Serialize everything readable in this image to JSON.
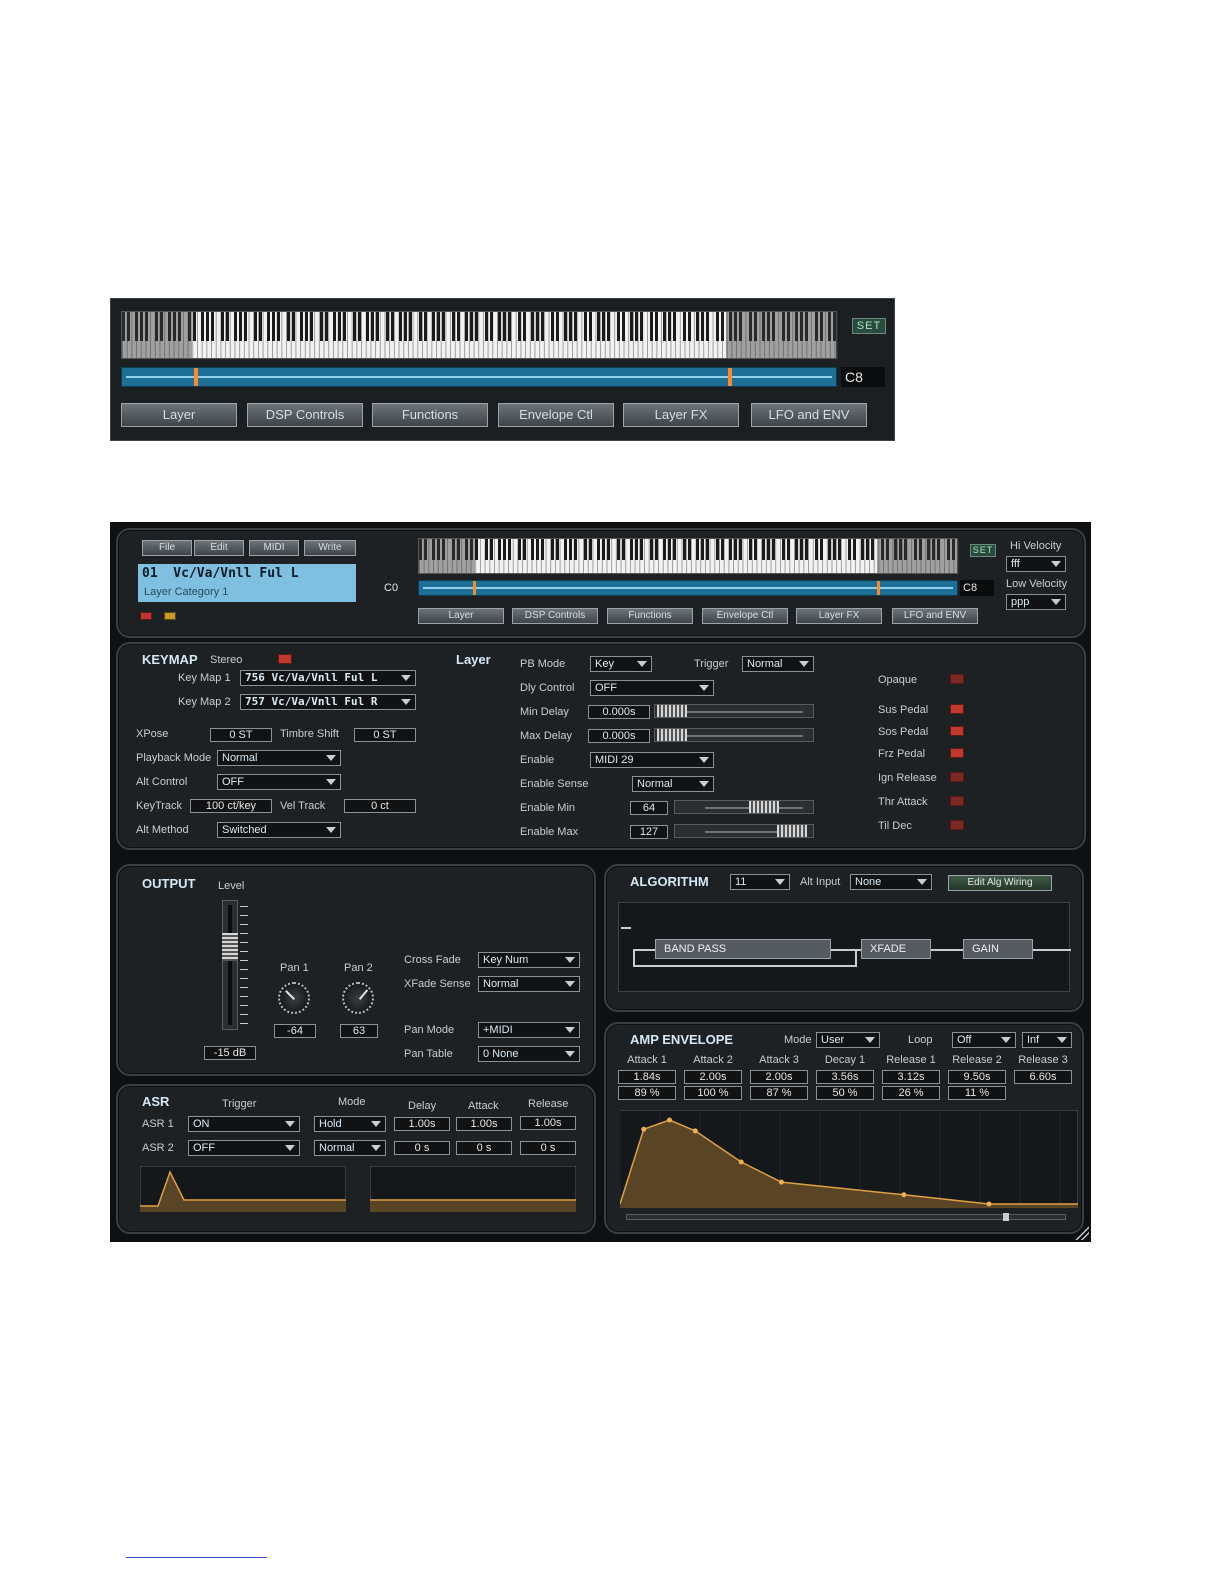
{
  "top_strip": {
    "key_label": "C8",
    "set_label": "SET",
    "tabs": [
      "Layer",
      "DSP Controls",
      "Functions",
      "Envelope Ctl",
      "Layer FX",
      "LFO and ENV"
    ]
  },
  "editor": {
    "menu": [
      "File",
      "Edit",
      "MIDI",
      "Write"
    ],
    "program_name": "01  Vc/Va/Vnll Ful L",
    "layer_category": "Layer Category 1",
    "key_low": "C0",
    "key_high": "C8",
    "set_label": "SET",
    "hi_velocity_label": "Hi Velocity",
    "hi_velocity": "fff",
    "low_velocity_label": "Low Velocity",
    "low_velocity": "ppp",
    "tabs": [
      "Layer",
      "DSP Controls",
      "Functions",
      "Envelope Ctl",
      "Layer FX",
      "LFO and ENV"
    ]
  },
  "keymap": {
    "title": "KEYMAP",
    "stereo_label": "Stereo",
    "layer_label": "Layer",
    "key_map_1_label": "Key Map 1",
    "key_map_1": "756 Vc/Va/Vnll Ful L",
    "key_map_2_label": "Key Map 2",
    "key_map_2": "757 Vc/Va/Vnll Ful R",
    "xpose_label": "XPose",
    "xpose": "0 ST",
    "timbre_shift_label": "Timbre Shift",
    "timbre_shift": "0 ST",
    "playback_mode_label": "Playback Mode",
    "playback_mode": "Normal",
    "alt_control_label": "Alt Control",
    "alt_control": "OFF",
    "keytrack_label": "KeyTrack",
    "keytrack": "100 ct/key",
    "vel_track_label": "Vel Track",
    "vel_track": "0 ct",
    "alt_method_label": "Alt Method",
    "alt_method": "Switched"
  },
  "layer": {
    "pb_mode_label": "PB Mode",
    "pb_mode": "Key",
    "trigger_label": "Trigger",
    "trigger": "Normal",
    "dly_control_label": "Dly Control",
    "dly_control": "OFF",
    "min_delay_label": "Min Delay",
    "min_delay": "0.000s",
    "max_delay_label": "Max Delay",
    "max_delay": "0.000s",
    "enable_label": "Enable",
    "enable": "MIDI 29",
    "enable_sense_label": "Enable Sense",
    "enable_sense": "Normal",
    "enable_min_label": "Enable Min",
    "enable_min": "64",
    "enable_max_label": "Enable Max",
    "enable_max": "127",
    "opaque_label": "Opaque",
    "sus_pedal_label": "Sus Pedal",
    "sos_pedal_label": "Sos Pedal",
    "frz_pedal_label": "Frz Pedal",
    "ign_release_label": "Ign Release",
    "thr_attack_label": "Thr Attack",
    "til_dec_label": "Til Dec"
  },
  "output": {
    "title": "OUTPUT",
    "level_label": "Level",
    "level": "-15 dB",
    "pan1_label": "Pan 1",
    "pan1": "-64",
    "pan2_label": "Pan 2",
    "pan2": "63",
    "cross_fade_label": "Cross Fade",
    "cross_fade": "Key Num",
    "xfade_sense_label": "XFade Sense",
    "xfade_sense": "Normal",
    "pan_mode_label": "Pan Mode",
    "pan_mode": "+MIDI",
    "pan_table_label": "Pan Table",
    "pan_table": "0 None"
  },
  "algorithm": {
    "title": "ALGORITHM",
    "number": "11",
    "alt_input_label": "Alt Input",
    "alt_input": "None",
    "edit_wiring": "Edit Alg Wiring",
    "blocks": [
      "BAND PASS",
      "XFADE",
      "GAIN"
    ]
  },
  "asr": {
    "title": "ASR",
    "col_trigger": "Trigger",
    "col_mode": "Mode",
    "col_delay": "Delay",
    "col_attack": "Attack",
    "col_release": "Release",
    "rows": [
      {
        "label": "ASR 1",
        "trigger": "ON",
        "mode": "Hold",
        "delay": "1.00s",
        "attack": "1.00s",
        "release": "1.00s"
      },
      {
        "label": "ASR 2",
        "trigger": "OFF",
        "mode": "Normal",
        "delay": "0 s",
        "attack": "0 s",
        "release": "0 s"
      }
    ]
  },
  "amp_envelope": {
    "title": "AMP ENVELOPE",
    "mode_label": "Mode",
    "mode": "User",
    "loop_label": "Loop",
    "loop": "Off",
    "loop_count": "Inf",
    "segments": [
      {
        "name": "Attack 1",
        "time": "1.84s",
        "level": "89 %"
      },
      {
        "name": "Attack 2",
        "time": "2.00s",
        "level": "100 %"
      },
      {
        "name": "Attack 3",
        "time": "2.00s",
        "level": "87 %"
      },
      {
        "name": "Decay 1",
        "time": "3.56s",
        "level": "50 %"
      },
      {
        "name": "Release 1",
        "time": "3.12s",
        "level": "26 %"
      },
      {
        "name": "Release 2",
        "time": "9.50s",
        "level": "11 %"
      },
      {
        "name": "Release 3",
        "time": "6.60s",
        "level": ""
      }
    ]
  },
  "colors": {
    "panel_bg": "#1e2124",
    "accent_blue": "#1d6f96",
    "led_red": "#c0392b",
    "envelope_fill": "#5a4426",
    "envelope_line": "#e0a040"
  }
}
